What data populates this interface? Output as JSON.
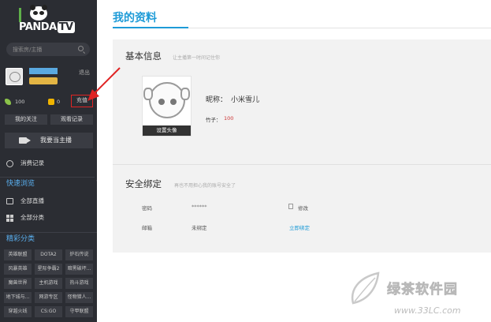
{
  "sidebar": {
    "logo_text": "PANDA",
    "logo_tv": "TV",
    "search_placeholder": "搜索房/主播",
    "logout": "退出",
    "level_badge": "",
    "bamboo_count": "100",
    "coin_count": "0",
    "recharge": "充值",
    "tab_follow": "我的关注",
    "tab_history": "观看记录",
    "streamer_button": "我要当主播",
    "consume_record": "消费记录",
    "quick_browse": "快速浏览",
    "all_live": "全部直播",
    "all_categories": "全部分类",
    "featured_categories": "精彩分类",
    "categories": [
      "英雄联盟",
      "DOTA2",
      "炉石传说",
      "风暴英雄",
      "星际争霸2",
      "暗黑破坏...",
      "魔兽世界",
      "主机游戏",
      "热斗游戏",
      "地下城与...",
      "网游专区",
      "怪物猎人...",
      "穿越火线",
      "CS:GO",
      "守甲联盟"
    ]
  },
  "main": {
    "page_title": "我的资料",
    "basic_info": "基本信息",
    "basic_info_sub": "让主播第一时间记住你",
    "set_avatar": "设置头像",
    "nickname_label": "昵称：",
    "nickname_value": "小米雪儿",
    "bamboo_label": "竹子：",
    "bamboo_value": "100",
    "security": "安全绑定",
    "security_sub": "再也不用担心我的账号安全了",
    "password_label": "密码",
    "password_value": "******",
    "edit": "修改",
    "email_label": "邮箱",
    "email_value": "未绑定",
    "bind_now": "立即绑定"
  },
  "watermark": {
    "title": "绿茶软件园",
    "url": "www.33LC.com"
  },
  "colors": {
    "sidebar_bg": "#2b2d33",
    "accent_blue": "#1e9bd7",
    "annotation_red": "#e02323"
  }
}
